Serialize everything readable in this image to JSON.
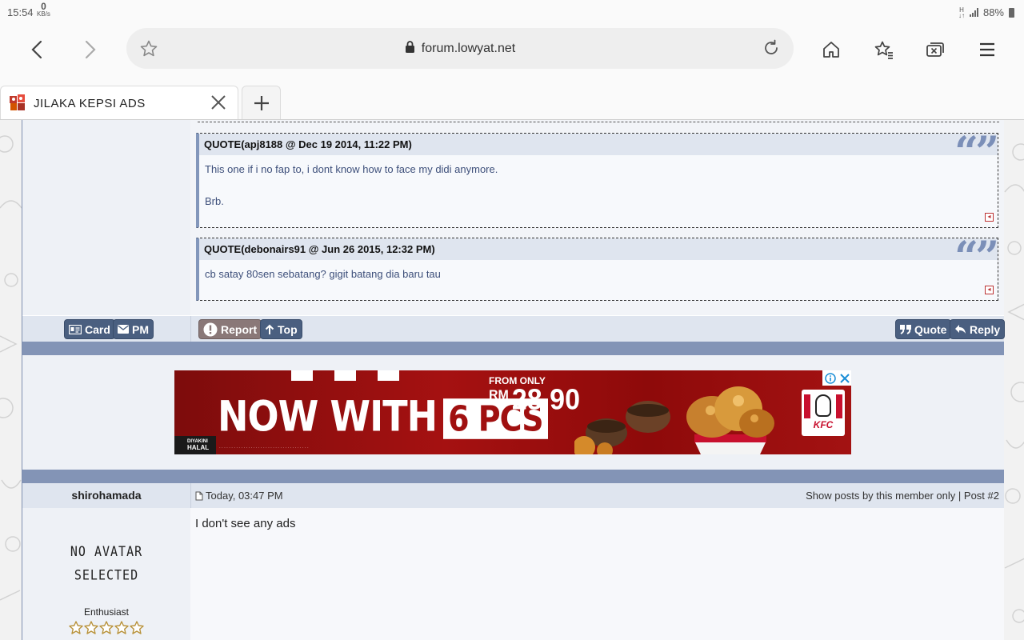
{
  "status_bar": {
    "time": "15:54",
    "net_speed_value": "0",
    "net_speed_unit": "KB/s",
    "battery": "88%"
  },
  "browser": {
    "url": "forum.lowyat.net",
    "tab_title": "JILAKA KEPSI ADS",
    "icons": [
      "back-icon",
      "forward-icon",
      "star-icon",
      "lock-icon",
      "reload-icon",
      "home-icon",
      "bookmarks-icon",
      "tabs-icon",
      "menu-icon",
      "close-icon",
      "plus-icon"
    ]
  },
  "quotes": [
    {
      "header": "QUOTE(apj8188 @ Dec 19 2014, 11:22 PM)",
      "lines": [
        "This one if i no fap to, i dont know how to face my didi anymore.",
        "Brb."
      ]
    },
    {
      "header": "QUOTE(debonairs91 @ Jun 26 2015, 12:32 PM)",
      "lines": [
        "cb satay 80sen sebatang? gigit batang dia baru tau"
      ]
    }
  ],
  "post_buttons": {
    "card": "Card",
    "pm": "PM",
    "report": "Report",
    "top": "Top",
    "quote": "Quote",
    "reply": "Reply"
  },
  "ad": {
    "headline": "NOW WITH",
    "badge": "6 PCS",
    "from_only": "FROM ONLY",
    "currency": "RM",
    "price": "28.90",
    "halal": "HALAL",
    "halal_small": "DIYAKINI",
    "brand": "KFC",
    "colors": {
      "background": "#a51111",
      "accent": "#c8102e"
    }
  },
  "post": {
    "username": "shirohamada",
    "date": "Today, 03:47 PM",
    "show_posts": "Show posts by this member only",
    "separator": "|",
    "post_number": "Post #2",
    "content": "I don't see any ads",
    "avatar_line1": "NO AVATAR",
    "avatar_line2": "SELECTED",
    "rank": "Enthusiast",
    "rating_stars": 5
  },
  "colors": {
    "forum_bar": "#8394b6",
    "button": "#4a5f80",
    "quote_border": "#8397bb"
  }
}
